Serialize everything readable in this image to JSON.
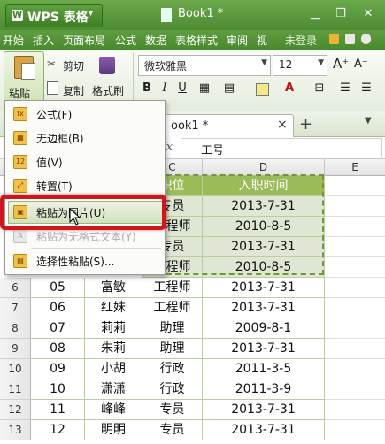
{
  "titlebar": {
    "app_logo": "W",
    "app_name": "WPS 表格",
    "app_menu_caret": "▾",
    "doc_title": "Book1 *",
    "window_buttons": [
      "▁",
      "❐",
      "✕"
    ]
  },
  "menubar": {
    "items": [
      "开始",
      "插入",
      "页面布局",
      "公式",
      "数据",
      "表格样式",
      "审阅",
      "视"
    ],
    "login": "未登录"
  },
  "ribbon": {
    "paste_label": "粘贴",
    "cut_label": "剪切",
    "copy_label": "复制",
    "format_painter_label": "格式刷",
    "font_name": "微软雅黑",
    "font_size": "12",
    "bold": "B",
    "italic": "I",
    "underline": "U",
    "grow_font": "A⁺",
    "shrink_font": "A⁻"
  },
  "tabs": {
    "sheet_tab_label": "ook1 *",
    "close": "×",
    "new_tab": "+"
  },
  "formula_bar": {
    "fx": "fx",
    "value": "工号"
  },
  "grid": {
    "col_heads": [
      "C",
      "D",
      "E"
    ],
    "row_numbers": [
      "6",
      "7",
      "8",
      "9",
      "10",
      "11",
      "12",
      "13"
    ],
    "header_cells": [
      "职位",
      "入职时间"
    ],
    "visible_upper_rows": [
      {
        "c": "专员",
        "d": "2013-7-31"
      },
      {
        "c": "工程师",
        "d": "2010-8-5"
      },
      {
        "c": "专员",
        "d": "2013-7-31"
      },
      {
        "c": "工程师",
        "d": "2010-8-5"
      }
    ],
    "rows": [
      {
        "num": "6",
        "a": "05",
        "b": "富敏",
        "c": "工程师",
        "d": "2013-7-31"
      },
      {
        "num": "7",
        "a": "06",
        "b": "红妹",
        "c": "工程师",
        "d": "2013-7-31"
      },
      {
        "num": "8",
        "a": "07",
        "b": "莉莉",
        "c": "助理",
        "d": "2009-8-1"
      },
      {
        "num": "9",
        "a": "08",
        "b": "朱莉",
        "c": "助理",
        "d": "2013-7-31"
      },
      {
        "num": "10",
        "a": "09",
        "b": "小胡",
        "c": "行政",
        "d": "2011-3-5"
      },
      {
        "num": "11",
        "a": "10",
        "b": "潇潇",
        "c": "行政",
        "d": "2011-3-9"
      },
      {
        "num": "12",
        "a": "11",
        "b": "峰峰",
        "c": "专员",
        "d": "2013-7-31"
      },
      {
        "num": "13",
        "a": "12",
        "b": "明明",
        "c": "专员",
        "d": "2013-7-31"
      }
    ]
  },
  "paste_menu": {
    "items": [
      {
        "label": "公式(F)",
        "icon": "formula-paste-icon",
        "enabled": true
      },
      {
        "label": "无边框(B)",
        "icon": "no-border-paste-icon",
        "enabled": true
      },
      {
        "label": "值(V)",
        "icon": "values-paste-icon",
        "enabled": true
      },
      {
        "label": "转置(T)",
        "icon": "transpose-paste-icon",
        "enabled": true
      },
      {
        "label": "粘贴为图片(U)",
        "icon": "paste-as-picture-icon",
        "enabled": true,
        "highlighted": true
      },
      {
        "label": "粘贴为无格式文本(Y)",
        "icon": "paste-plain-text-icon",
        "enabled": false
      },
      {
        "label": "选择性粘贴(S)...",
        "icon": "paste-special-icon",
        "enabled": true
      }
    ],
    "icon_glyphs": [
      "fx",
      "▦",
      "12",
      "⤢",
      "▣",
      "A",
      "▤"
    ]
  },
  "colors": {
    "title_green": "#5a9a3c",
    "header_green": "#9bbb59",
    "highlight_red": "#d0161a"
  }
}
